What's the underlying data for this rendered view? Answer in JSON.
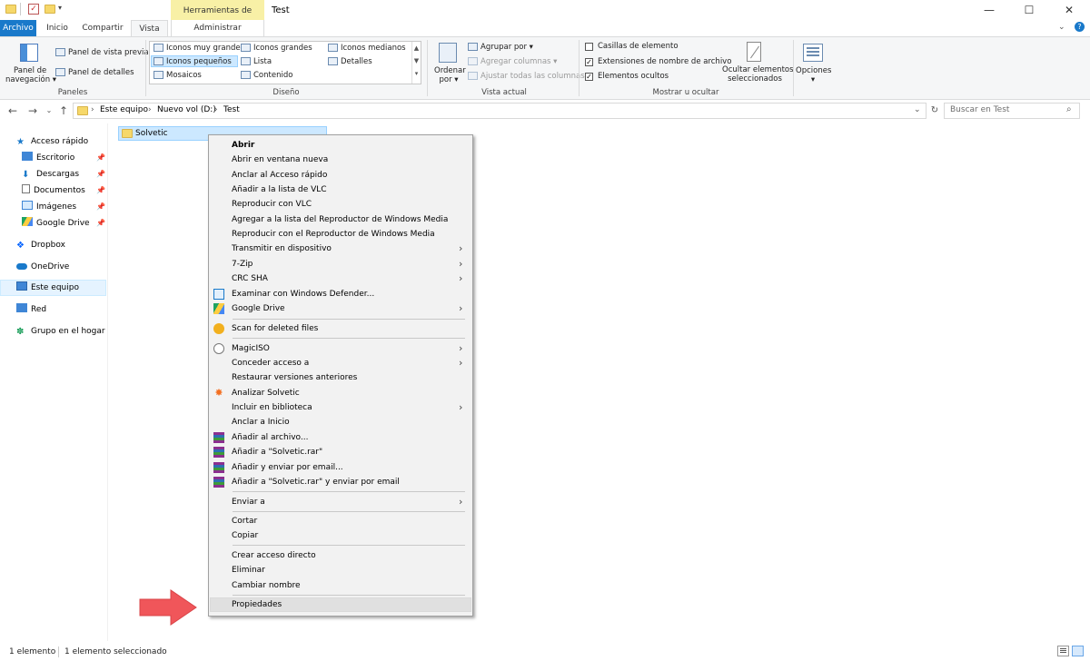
{
  "titlebar": {
    "contextual_tab_title": "Herramientas de imagen",
    "window_title": "Test",
    "controls": [
      "—",
      "☐",
      "✕"
    ]
  },
  "ribbon_tabs": [
    {
      "label": "Archivo"
    },
    {
      "label": "Inicio"
    },
    {
      "label": "Compartir"
    },
    {
      "label": "Vista",
      "active": true
    },
    {
      "label": "Administrar"
    }
  ],
  "ribbon": {
    "panes": {
      "nav_pane": [
        "Panel de",
        "navegación"
      ],
      "preview_pane": "Panel de vista previa",
      "details_pane": "Panel de detalles",
      "group": "Paneles"
    },
    "layout": {
      "items": [
        "Iconos muy grandes",
        "Iconos grandes",
        "Iconos medianos",
        "Iconos pequeños",
        "Lista",
        "Detalles",
        "Mosaicos",
        "Contenido"
      ],
      "selected": "Iconos pequeños",
      "group": "Diseño"
    },
    "current_view": {
      "sort": [
        "Ordenar",
        "por"
      ],
      "group_by": "Agrupar por",
      "add_columns": "Agregar columnas",
      "fit_columns": "Ajustar todas las columnas",
      "group": "Vista actual"
    },
    "show_hide": {
      "item_checkboxes": {
        "label": "Casillas de elemento",
        "checked": false
      },
      "extensions": {
        "label": "Extensiones de nombre de archivo",
        "checked": true
      },
      "hidden_items": {
        "label": "Elementos ocultos",
        "checked": true
      },
      "hide_selected": [
        "Ocultar elementos",
        "seleccionados"
      ],
      "group": "Mostrar u ocultar"
    },
    "options": "Opciones"
  },
  "address": {
    "crumbs": [
      "Este equipo",
      "Nuevo vol (D:)",
      "Test"
    ],
    "search_placeholder": "Buscar en Test"
  },
  "nav": {
    "quick_access": "Acceso rápido",
    "pinned": [
      "Escritorio",
      "Descargas",
      "Documentos",
      "Imágenes",
      "Google Drive"
    ],
    "dropbox": "Dropbox",
    "onedrive": "OneDrive",
    "this_pc": "Este equipo",
    "network": "Red",
    "homegroup": "Grupo en el hogar"
  },
  "files": [
    {
      "name": "Solvetic"
    }
  ],
  "context_menu": {
    "items": [
      "Abrir",
      "Abrir en ventana nueva",
      "Anclar al Acceso rápido",
      "Añadir a la lista de VLC",
      "Reproducir con VLC",
      "Agregar a la lista del Reproductor de Windows Media",
      "Reproducir con el Reproductor de Windows Media",
      "Transmitir en dispositivo",
      "7-Zip",
      "CRC SHA",
      "Examinar con Windows Defender...",
      "Google Drive",
      "Scan for deleted files",
      "MagicISO",
      "Conceder acceso a",
      "Restaurar versiones anteriores",
      "Analizar Solvetic",
      "Incluir en biblioteca",
      "Anclar a Inicio",
      "Añadir al archivo...",
      "Añadir a \"Solvetic.rar\"",
      "Añadir y enviar por email...",
      "Añadir a \"Solvetic.rar\" y enviar por email",
      "Enviar a",
      "Cortar",
      "Copiar",
      "Crear acceso directo",
      "Eliminar",
      "Cambiar nombre",
      "Propiedades"
    ]
  },
  "status": {
    "count": "1 elemento",
    "selected": "1 elemento seleccionado"
  },
  "colors": {
    "accent": "#1979ca",
    "contextual_tab": "#f8f0a6",
    "selection": "#cce8ff",
    "arrow": "#f0565a"
  }
}
